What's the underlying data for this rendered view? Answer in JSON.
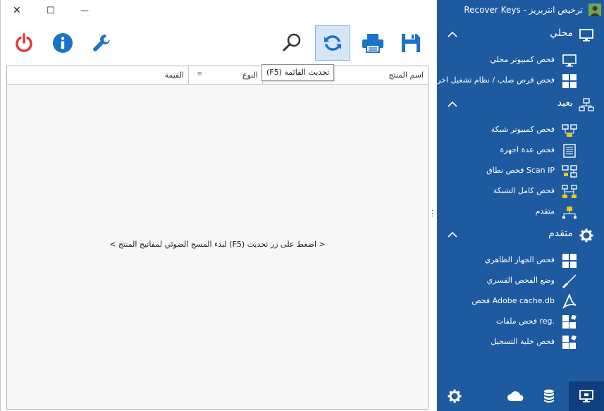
{
  "window": {
    "title": "Recover Keys - ترخيص انتربريز",
    "controls": {
      "minimize": "—",
      "maximize": "☐",
      "close": "✕"
    }
  },
  "toolbar": {
    "left_buttons": [
      {
        "name": "power",
        "icon": "power-icon"
      },
      {
        "name": "info",
        "icon": "info-icon"
      },
      {
        "name": "settings",
        "icon": "wrench-icon"
      }
    ],
    "right_buttons": [
      {
        "name": "search",
        "icon": "search-icon"
      },
      {
        "name": "refresh",
        "icon": "refresh-icon",
        "active": true
      },
      {
        "name": "print",
        "icon": "printer-icon"
      },
      {
        "name": "save",
        "icon": "save-icon"
      }
    ],
    "tooltip": "تحديث القائمة (F5)"
  },
  "table": {
    "columns": [
      "اسم المنتج",
      "النوع",
      "القيمة"
    ],
    "empty_message": "< اضغط على زر تحديث (F5) لبدء المسح الضوئي لمفاتيح المنتج >"
  },
  "sidebar": {
    "sections": [
      {
        "label": "محلي",
        "icon": "monitor-icon",
        "items": [
          {
            "label": "فحص كمبيوتر محلي",
            "icon": "monitor-icon"
          },
          {
            "label": "فحص قرص صلب / نظام تشغيل اخر",
            "icon": "windows-icon"
          }
        ]
      },
      {
        "label": "بعيد",
        "icon": "network-icon",
        "items": [
          {
            "label": "فحص كمبيوتر شبكة",
            "icon": "network-computers-icon"
          },
          {
            "label": "فحص عدة اجهزة",
            "icon": "list-icon"
          },
          {
            "label": "Scan IP فحص نطاق",
            "icon": "network-range-icon"
          },
          {
            "label": "فحص كامل الشبكة",
            "icon": "network-full-icon"
          },
          {
            "label": "متقدم",
            "icon": "network-advanced-icon"
          }
        ]
      },
      {
        "label": "متقدم",
        "icon": "gear-icon",
        "items": [
          {
            "label": "فحص الجهاز الظاهري",
            "icon": "windows-icon"
          },
          {
            "label": "وضع الفحص القسري",
            "icon": "screwdriver-icon"
          },
          {
            "label": "Adobe cache.db فحص",
            "icon": "adobe-icon"
          },
          {
            "label": ".reg فحص ملفات",
            "icon": "registry-icon"
          },
          {
            "label": "فحص خلية التسجيل",
            "icon": "registry-icon"
          }
        ]
      }
    ],
    "bottom_buttons": [
      {
        "name": "settings",
        "icon": "gear-icon"
      },
      {
        "name": "cloud",
        "icon": "cloud-icon"
      },
      {
        "name": "database",
        "icon": "database-icon"
      },
      {
        "name": "local",
        "icon": "monitor-icon",
        "active": true
      }
    ]
  },
  "colors": {
    "sidebar_bg": "#1e5aa0",
    "accent": "#1a73c9",
    "power_red": "#e53935"
  }
}
